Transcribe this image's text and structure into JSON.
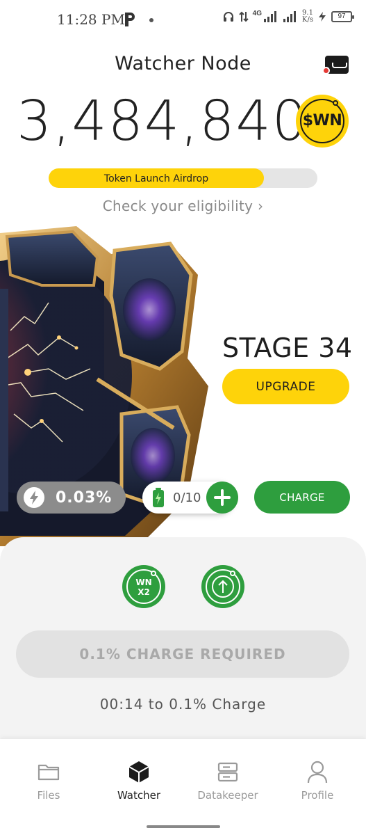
{
  "status_bar": {
    "time": "11:28 PM",
    "network": "4G",
    "speed_value": "9.1",
    "speed_unit": "K/s",
    "battery": "97"
  },
  "header": {
    "title": "Watcher Node",
    "wallet_icon": "wallet-icon",
    "notification_color": "#e53935"
  },
  "balance": {
    "amount": "3,484,840",
    "token": "$WN"
  },
  "airdrop": {
    "label": "Token Launch Airdrop",
    "progress_percent": 80,
    "eligibility_link": "Check your eligibility",
    "chevron": "›"
  },
  "node": {
    "stage": "STAGE 34",
    "upgrade_label": "UPGRADE",
    "energy_icon": "bolt-icon",
    "energy_value": "0.03%",
    "battery_count": "0/10",
    "charge_label": "CHARGE"
  },
  "panel": {
    "boost_label_top": "WN",
    "boost_label_bottom": "X2",
    "required_label": "0.1% CHARGE REQUIRED",
    "countdown": "00:14 to 0.1% Charge"
  },
  "nav": {
    "items": [
      {
        "label": "Files",
        "icon": "folder-icon",
        "active": false
      },
      {
        "label": "Watcher",
        "icon": "cube-icon",
        "active": true
      },
      {
        "label": "Datakeeper",
        "icon": "server-icon",
        "active": false
      },
      {
        "label": "Profile",
        "icon": "person-icon",
        "active": false
      }
    ]
  },
  "colors": {
    "accent_yellow": "#fed30a",
    "accent_green": "#2e9e3e",
    "gray_pill": "#8c8c8c"
  }
}
